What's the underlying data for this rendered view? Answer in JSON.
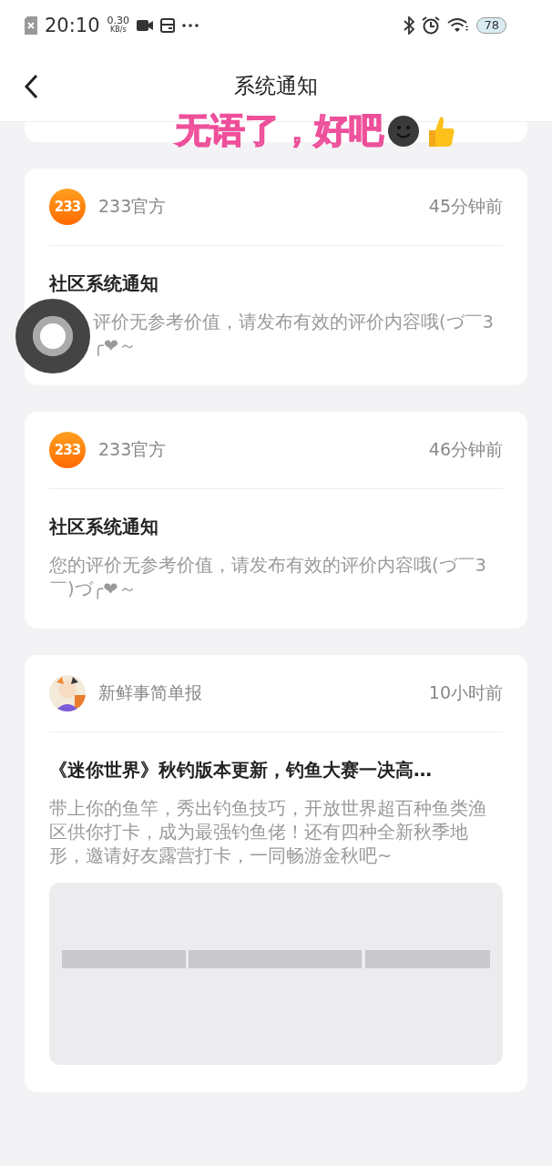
{
  "status_bar": {
    "time": "20:10",
    "speed": "0.30",
    "speed_unit": "KB/s",
    "battery": "78"
  },
  "header": {
    "title": "系统通知"
  },
  "caption": {
    "text": "无语了，好吧"
  },
  "notifications": [
    {
      "avatar": {
        "kind": "logo",
        "text": "233"
      },
      "sender": "233官方",
      "time": "45分钟前",
      "title": "社区系统通知",
      "covered_by_overlay": true,
      "body_lines": [
        "评价无参考价值，请发布有效的评价内容哦(づ￣3",
        "╭❤～"
      ]
    },
    {
      "avatar": {
        "kind": "logo",
        "text": "233"
      },
      "sender": "233官方",
      "time": "46分钟前",
      "title": "社区系统通知",
      "body": "您的评价无参考价值，请发布有效的评价内容哦(づ￣3￣)づ╭❤～"
    },
    {
      "sender": "新鲜事简单报",
      "time": "10小时前",
      "title": "《迷你世界》秋钓版本更新，钓鱼大赛一决高…",
      "body": "带上你的鱼竿，秀出钓鱼技巧，开放世界超百种鱼类渔区供你打卡，成为最强钓鱼佬！还有四种全新秋季地形，邀请好友露营打卡，一同畅游金秋吧~"
    }
  ]
}
